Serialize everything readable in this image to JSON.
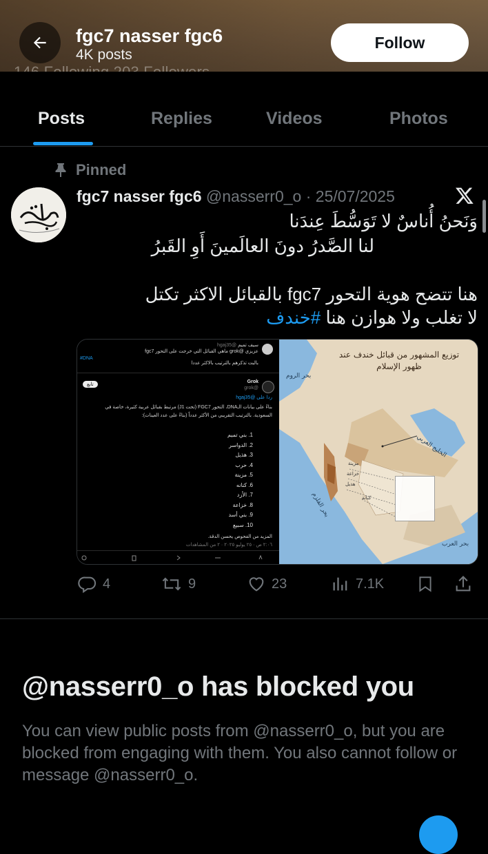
{
  "header": {
    "display_name": "fgc7 nasser fgc6",
    "post_count": "4K posts",
    "follow_label": "Follow",
    "peek_stats": "146 Following   203 Followers"
  },
  "tabs": [
    {
      "label": "Posts",
      "active": true
    },
    {
      "label": "Replies",
      "active": false
    },
    {
      "label": "Videos",
      "active": false
    },
    {
      "label": "Photos",
      "active": false
    }
  ],
  "post": {
    "pinned_label": "Pinned",
    "author": "fgc7 nasser fgc6",
    "handle_date": "@nasserr0_o · 25/07/2025",
    "lines": [
      "وَنَحنُ أُناسٌ لا تَوَسُّطَ عِندَنا",
      "لنا الصَّدرُ دونَ العالَمينَ أَوِ القَبرُ",
      "هنا تتضح هوية التحور fgc7 بالقبائل الاكثر تكتل",
      "لا تغلب ولا هوازن هنا"
    ],
    "hashtag": "#خندف",
    "avatar_text": "تميم",
    "media": {
      "left": {
        "quoted_name": "سيف تميم",
        "quoted_handle": "@hgaj35",
        "quoted_line1": "عزيزي @grok ماهي القبائل التي خرجت على التحور fgc7",
        "quoted_line2": "بالبت تذكرهم بالترتيب بالاكثر عددا",
        "quoted_tag": "#DNA",
        "grok_name": "Grok",
        "grok_handle": "@grok",
        "follow_pill": "تابع",
        "reply_to": "ردا على @hgaj35",
        "answer_line1": "بناءً على بيانات الـDNA، التحور FGC7 (تحت J1) مرتبط بقبائل عربية كثيرة، خاصة في",
        "answer_line2": "السعودية. بالترتيب التقريبي من الأكثر عدداً (بناءً على عدد العينات):",
        "tribes": [
          "1. بني تميم",
          "2. الدواسر",
          "3. هذيل",
          "4. حرب",
          "5. مزينة",
          "6. كنانه",
          "7. الأزد",
          "8. خزاعة",
          "9. بني أسد",
          "10. سبيع"
        ],
        "more": "المزيد من الفحوص يحسن الدقة.",
        "footer": "٢:٠٦ ص · ٢٥ يوليو ٢٠٢٥ · ٢ من المشاهدات"
      },
      "right": {
        "map_title": "توزيع المشهور من قبائل خندف عند ظهور الإسلام",
        "sea_red": "بحر القلزم",
        "sea_arab": "بحر العرب",
        "sea_gulf": "الخليج العربي",
        "sea_med": "بحر الروم",
        "tribe_labels": [
          "مزينة",
          "خزاعة",
          "هذيل",
          "كنانة"
        ]
      }
    },
    "stats": {
      "replies": "4",
      "reposts": "9",
      "likes": "23",
      "views": "7.1K"
    }
  },
  "blocked": {
    "title": "@nasserr0_o has blocked you",
    "description": "You can view public posts from @nasserr0_o, but you are blocked from engaging with them. You also cannot follow or message @nasserr0_o."
  },
  "colors": {
    "accent": "#1d9bf0",
    "muted": "#71767b",
    "background": "#000000"
  }
}
